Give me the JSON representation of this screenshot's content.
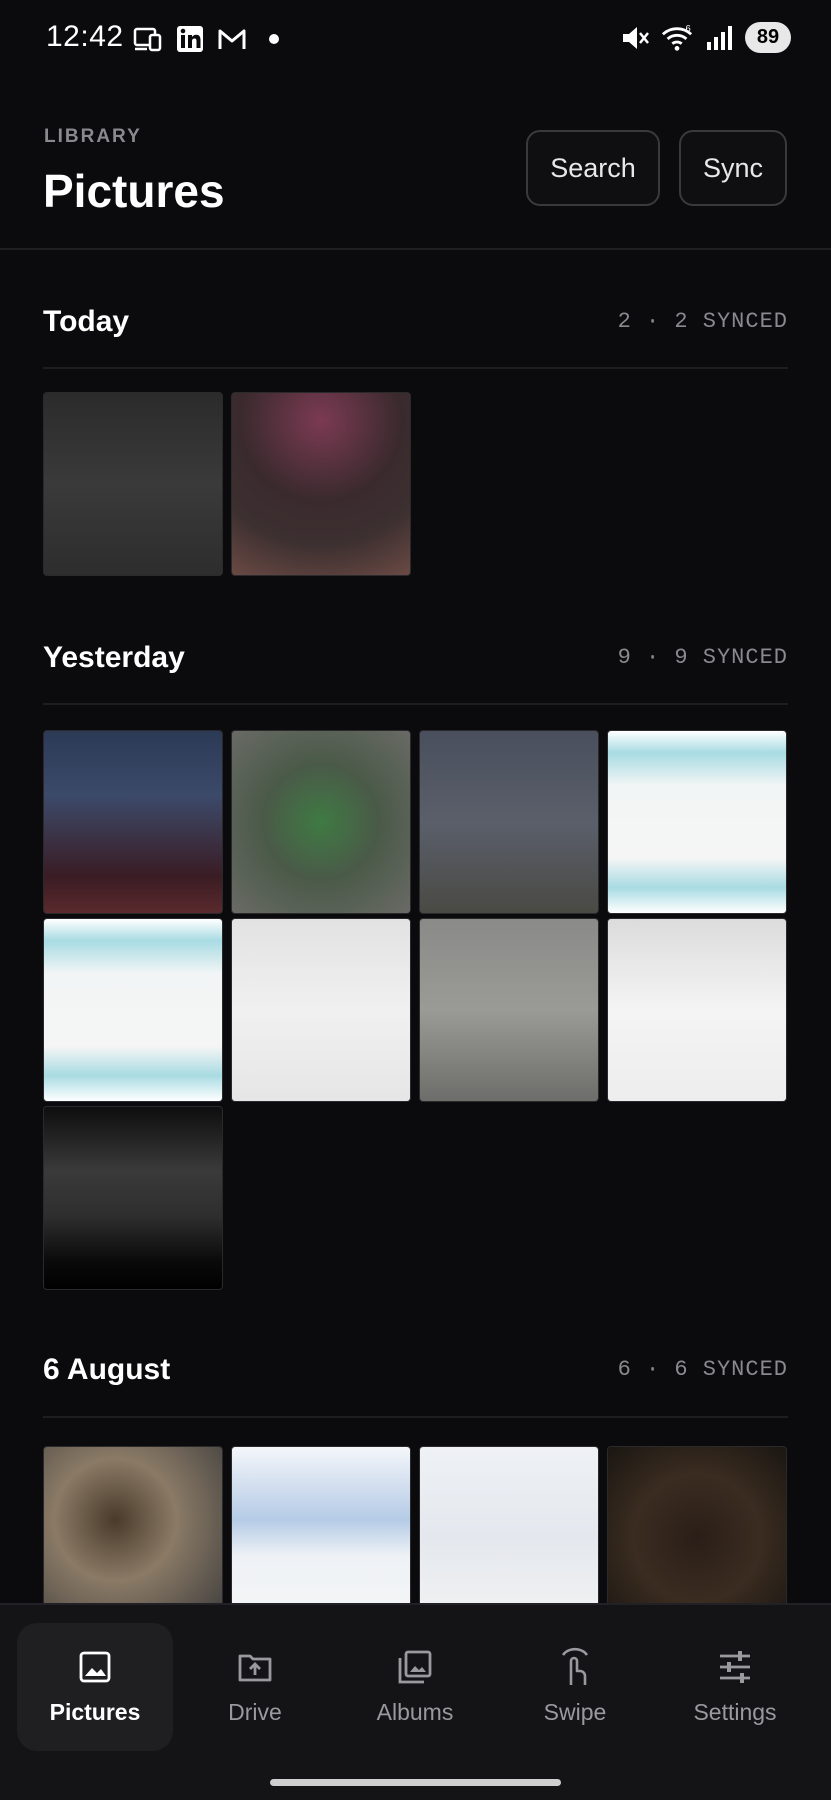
{
  "status_bar": {
    "time": "12:42",
    "battery": "89",
    "left_icons": [
      "phone-link-icon",
      "linkedin-icon",
      "gmail-icon",
      "notification-dot-icon"
    ],
    "right_icons": [
      "mute-icon",
      "wifi-icon",
      "signal-icon"
    ]
  },
  "header": {
    "eyebrow": "LIBRARY",
    "title": "Pictures",
    "search_label": "Search",
    "sync_label": "Sync"
  },
  "sections": [
    {
      "title": "Today",
      "meta": "2 · 2 SYNCED",
      "thumbs": 2
    },
    {
      "title": "Yesterday",
      "meta": "9 · 9 SYNCED",
      "thumbs": 9
    },
    {
      "title": "6 August",
      "meta": "6 · 6 SYNCED",
      "thumbs": 4
    }
  ],
  "nav": {
    "items": [
      {
        "label": "Pictures",
        "icon": "image-icon",
        "active": true
      },
      {
        "label": "Drive",
        "icon": "upload-folder-icon",
        "active": false
      },
      {
        "label": "Albums",
        "icon": "albums-icon",
        "active": false
      },
      {
        "label": "Swipe",
        "icon": "swipe-icon",
        "active": false
      },
      {
        "label": "Settings",
        "icon": "sliders-icon",
        "active": false
      }
    ]
  }
}
